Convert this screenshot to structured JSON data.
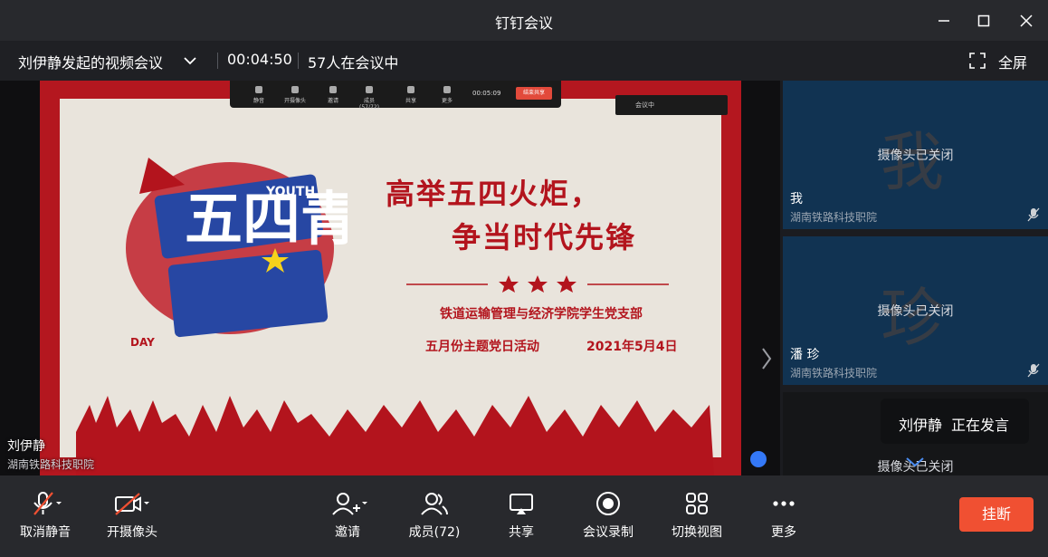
{
  "window": {
    "title": "钉钉会议"
  },
  "info": {
    "meeting_title": "刘伊静发起的视频会议",
    "elapsed": "00:04:50",
    "participants_in_meeting": "57人在会议中",
    "fullscreen_label": "全屏"
  },
  "shared_slide": {
    "headline_1": "高举五四火炬，",
    "headline_2": "争当时代先锋",
    "subtitle": "铁道运输管理与经济学院学生党支部",
    "event": "五月份主题党日活动",
    "date": "2021年5月4日",
    "art_text": "五四青年节",
    "art_word": "YOUTH",
    "art_day": "DAY",
    "mini_toolbar": {
      "items": [
        "静音",
        "开摄像头",
        "邀请",
        "成员(57/72)",
        "共享",
        "更多"
      ],
      "time": "00:05:09",
      "end": "结束共享"
    },
    "mini_status": "会议中"
  },
  "presenter": {
    "name": "刘伊静",
    "org": "湖南铁路科技职院"
  },
  "participants": [
    {
      "avatar_char": "我",
      "camera_status": "摄像头已关闭",
      "name": "我",
      "org": "湖南铁路科技职院"
    },
    {
      "avatar_char": "珍",
      "camera_status": "摄像头已关闭",
      "name": "潘 珍",
      "org": "湖南铁路科技职院"
    },
    {
      "camera_status": "摄像头已关闭"
    }
  ],
  "speaking_indicator": {
    "name": "刘伊静",
    "status": "正在发言"
  },
  "toolbar": {
    "unmute": "取消静音",
    "camera": "开摄像头",
    "invite": "邀请",
    "members": "成员(72)",
    "share": "共享",
    "record": "会议录制",
    "switch_view": "切换视图",
    "more": "更多",
    "hangup": "挂断"
  },
  "colors": {
    "accent_red": "#b3141d",
    "hangup": "#f05032",
    "tile_bg": "#113352"
  }
}
